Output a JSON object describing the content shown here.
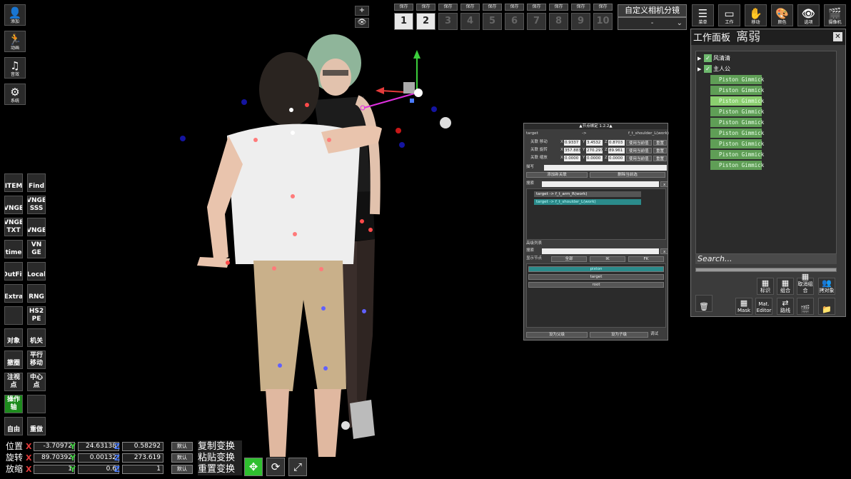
{
  "scene_slots": {
    "save_label": "保存",
    "numbers": [
      "1",
      "2",
      "3",
      "4",
      "5",
      "6",
      "7",
      "8",
      "9",
      "10"
    ],
    "active": [
      1,
      2
    ]
  },
  "camera": {
    "label": "自定义相机分镜",
    "value": "-"
  },
  "top_small": {
    "plus": "+",
    "eye": "👁"
  },
  "left_top": [
    {
      "name": "add",
      "glyph": "👤",
      "label": "添加"
    },
    {
      "name": "animation",
      "glyph": "🏃",
      "label": "动画"
    },
    {
      "name": "sound",
      "glyph": "♫",
      "label": "音效"
    },
    {
      "name": "system",
      "glyph": "⚙",
      "label": "系统"
    }
  ],
  "left_grid": [
    [
      "ITEM",
      "Find"
    ],
    [
      "VNGE",
      "VNGE SSS"
    ],
    [
      "VNGE TXT",
      "VNGE"
    ],
    [
      "time",
      "VN GE"
    ],
    [
      "OutFit",
      "Local"
    ],
    [
      "Extra",
      "RNG"
    ],
    [
      "",
      "HS2 PE"
    ],
    [
      "对象",
      "机关"
    ],
    [
      "撤圈",
      "平行移动"
    ],
    [
      "注视点",
      "中心点"
    ],
    [
      "操作轴",
      ""
    ],
    [
      "自由",
      "重做"
    ]
  ],
  "top_right": [
    {
      "name": "menu",
      "glyph": "☰",
      "label": "菜单"
    },
    {
      "name": "work",
      "glyph": "▭",
      "label": "工作"
    },
    {
      "name": "move",
      "glyph": "✋",
      "label": "移动"
    },
    {
      "name": "color",
      "glyph": "🎨",
      "label": "颜色"
    },
    {
      "name": "options",
      "glyph": "👁",
      "label": "选项"
    },
    {
      "name": "camera",
      "glyph": "🎬",
      "label": "摄像机"
    }
  ],
  "work_panel": {
    "title": "工作面板",
    "watermark": "离弱",
    "close": "✕",
    "tree": [
      {
        "label": "风清清",
        "checked": true
      },
      {
        "label": "主人公",
        "checked": true
      }
    ],
    "gimmicks": [
      "Piston Gimmick",
      "Piston Gimmick",
      "Piston Gimmick",
      "Piston Gimmick",
      "Piston Gimmick",
      "Piston Gimmick",
      "Piston Gimmick",
      "Piston Gimmick",
      "Piston Gimmick"
    ],
    "search": "Search...",
    "buttons": [
      {
        "glyph": "▦",
        "label": "标识"
      },
      {
        "glyph": "▦",
        "label": "组合"
      },
      {
        "glyph": "▦",
        "label": "取消组合"
      },
      {
        "glyph": "👥",
        "label": "拷对象"
      },
      {
        "glyph": "▦",
        "label": "Mask"
      },
      {
        "glyph": "",
        "label": "Mat. Editor"
      },
      {
        "glyph": "⇄",
        "label": "路线"
      },
      {
        "glyph": "🎬",
        "label": ""
      },
      {
        "glyph": "📁",
        "label": ""
      },
      {
        "glyph": "🗑",
        "label": ""
      }
    ]
  },
  "node_constraint": {
    "title": "▲节点绑定 1.2.2▲",
    "target_label": "target",
    "arrow": "->",
    "target_value": "f_t_shoulder_L(work)",
    "rows": [
      {
        "label": "关联 移动",
        "x": "0.9337",
        "y": "3.4532",
        "z": "0.8703",
        "use": "使用当前值",
        "reset": "重置"
      },
      {
        "label": "关联 旋转",
        "x": "357.883",
        "y": "270.297",
        "z": "89.961",
        "use": "使用当前值",
        "reset": "重置"
      },
      {
        "label": "关联 缩放",
        "x": "0.0000",
        "y": "0.0000",
        "z": "0.0000",
        "use": "使用当前值",
        "reset": "重置"
      }
    ],
    "desc_label": "描写",
    "add_btn": "添加新关联",
    "delete_btn": "删除当前选",
    "search_label": "搜索",
    "links": [
      "target -> f_t_arm_R(work)",
      "target -> f_t_shoulder_L(work)"
    ],
    "filter_label": "高级列表",
    "search2_label": "搜索",
    "show_label": "显示节点",
    "filters": [
      "全部",
      "IK",
      "FK"
    ],
    "nodes": [
      "piston",
      "target",
      "root"
    ],
    "parent_btn": "设为父级",
    "child_btn": "设为子级",
    "debug": "调试"
  },
  "transform": {
    "rows": [
      {
        "label": "位置",
        "x": "-3.70972",
        "y": "24.63138",
        "z": "0.58292",
        "def": "默认"
      },
      {
        "label": "旋转",
        "x": "89.70392",
        "y": "0.00132",
        "z": "273.619",
        "def": "默认"
      },
      {
        "label": "放缩",
        "x": "1",
        "y": "0.6",
        "z": "1",
        "def": "默认"
      }
    ],
    "ops": [
      "复制变换",
      "粘贴变换",
      "重置变换"
    ]
  },
  "colors": {
    "x_axis": "#e53b3b",
    "y_axis": "#3ccf3c",
    "z_axis": "#4a7cff",
    "gimmick": "#5f9e56"
  }
}
